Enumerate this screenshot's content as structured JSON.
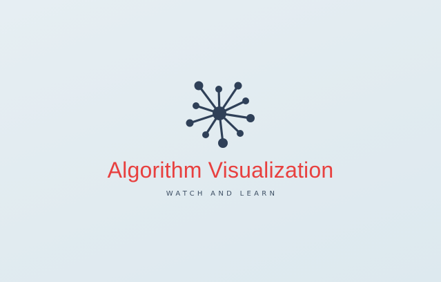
{
  "brand": {
    "title": "Algorithm Visualization",
    "tagline": "WATCH AND LEARN",
    "logo_icon": "network-node-icon"
  },
  "colors": {
    "background": "#e2ecf1",
    "title": "#e8403f",
    "tagline": "#3d4f64",
    "logo": "#2f4058"
  }
}
